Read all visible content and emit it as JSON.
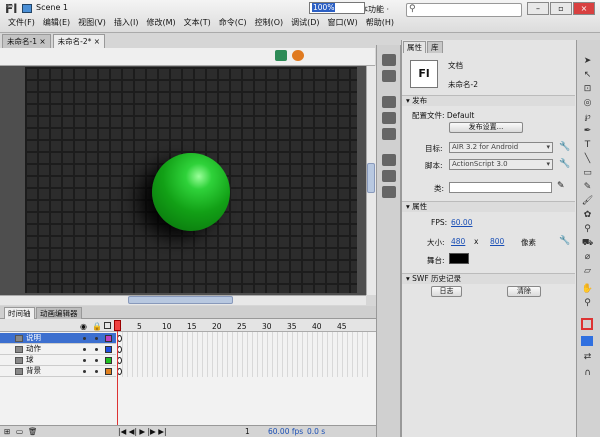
{
  "app": {
    "logo": "Fl",
    "workspace": "基本功能 ·"
  },
  "menu": [
    "文件(F)",
    "编辑(E)",
    "视图(V)",
    "插入(I)",
    "修改(M)",
    "文本(T)",
    "命令(C)",
    "控制(O)",
    "调试(D)",
    "窗口(W)",
    "帮助(H)"
  ],
  "doc_tabs": [
    {
      "label": "未命名-1 ×"
    },
    {
      "label": "未命名-2* ×"
    }
  ],
  "scene": {
    "label": "Scene 1",
    "zoom": "100%"
  },
  "timeline": {
    "tabs": [
      "时间轴",
      "动画编辑器"
    ],
    "frame_numbers": [
      "1",
      "5",
      "10",
      "15",
      "20",
      "25",
      "30",
      "35",
      "40",
      "45"
    ],
    "layers": [
      {
        "name": "说明",
        "color": "#c040c0",
        "selected": true
      },
      {
        "name": "动作",
        "color": "#2050e0",
        "selected": false
      },
      {
        "name": "球",
        "color": "#20c020",
        "selected": false
      },
      {
        "name": "背景",
        "color": "#e08020",
        "selected": false
      }
    ],
    "status": {
      "frame": "1",
      "fps": "60.00 fps",
      "time": "0.0 s"
    }
  },
  "properties": {
    "tabs": [
      "属性",
      "库"
    ],
    "doc_icon": "Fl",
    "doc_type": "文档",
    "doc_name": "未命名-2",
    "publish_section": "发布",
    "profile_label": "配置文件: Default",
    "publish_settings_btn": "发布设置...",
    "target_label": "目标:",
    "target_value": "AIR 3.2 for Android",
    "script_label": "脚本:",
    "script_value": "ActionScript 3.0",
    "class_label": "类:",
    "props_section": "属性",
    "fps_label": "FPS:",
    "fps_value": "60.00",
    "size_label": "大小:",
    "width": "480",
    "x_sep": "x",
    "height": "800",
    "unit": "像素",
    "stage_label": "舞台:",
    "stage_color": "#000000",
    "swf_section": "SWF 历史记录",
    "log_btn": "日志",
    "clear_btn": "清除"
  }
}
